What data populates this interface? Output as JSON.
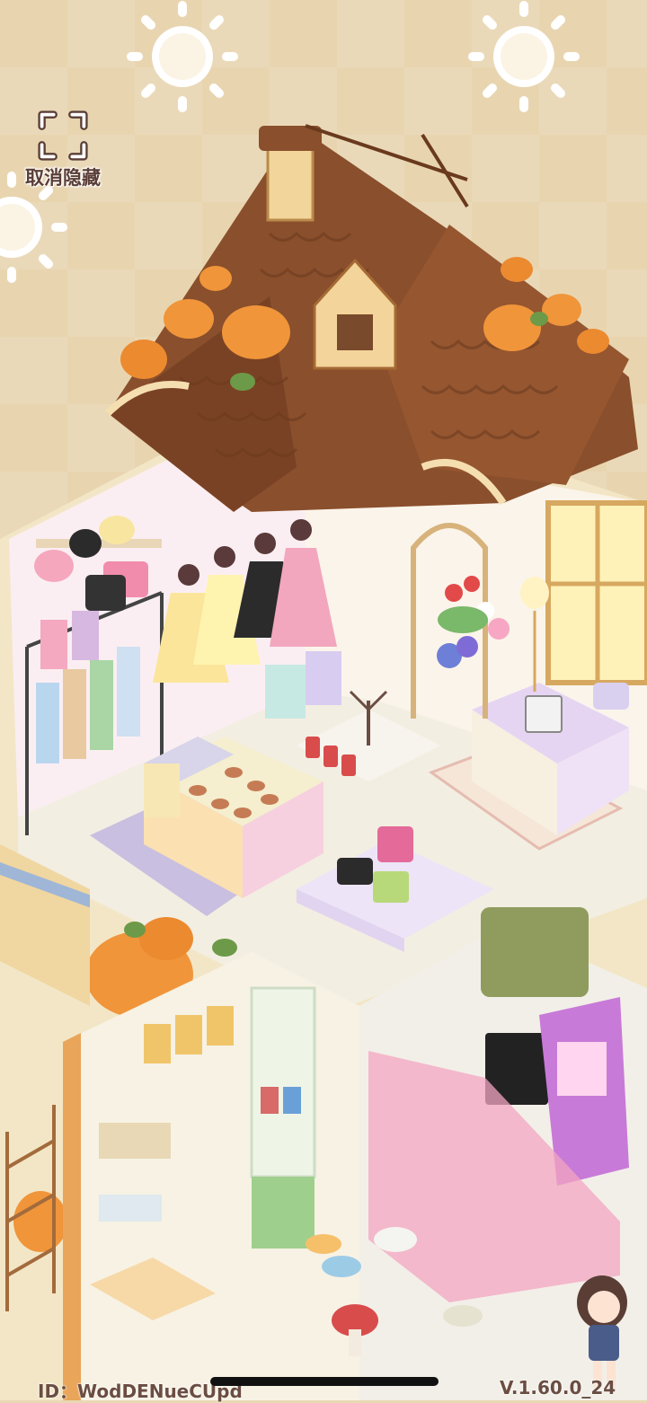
{
  "hud": {
    "unhide_label": "取消隐藏"
  },
  "footer": {
    "player_id": "ID：WodDENueCUpd",
    "version": "V.1.60.0_24"
  },
  "scene": {
    "name": "isometric-dollhouse-shop",
    "rooms": [
      "boutique-upper-floor",
      "crafts-lower-room",
      "arcade-room"
    ]
  },
  "colors": {
    "background": "#e8d5b0",
    "roof": "#8a4f2c",
    "wall": "#f4e7c8",
    "floor": "#f2ecde",
    "pumpkin": "#f0953a",
    "text": "#5a3e36"
  }
}
